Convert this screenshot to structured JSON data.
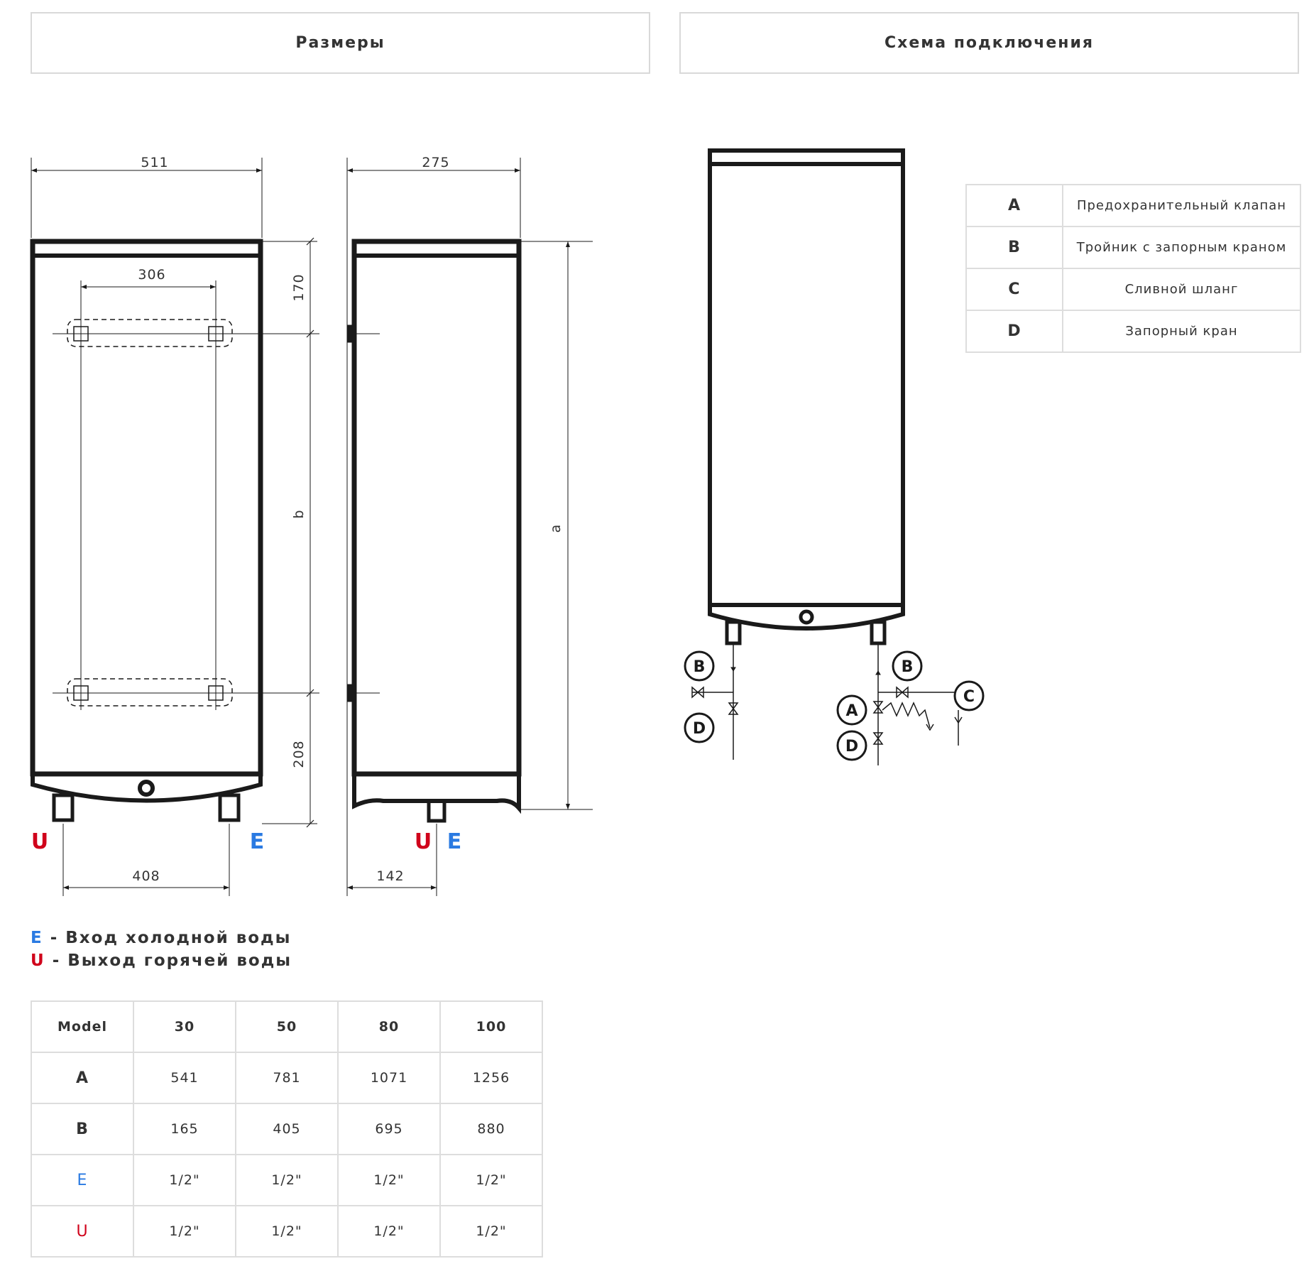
{
  "tabs": {
    "dimensions": "Размеры",
    "connection": "Схема подключения"
  },
  "colors": {
    "cold": "#2a7ae2",
    "hot": "#d0021b",
    "line": "#1a1a1a"
  },
  "front_view": {
    "width": "511",
    "mount_spacing": "306",
    "top_offset": "170",
    "b_label": "b",
    "bottom_offset": "208",
    "pipe_spacing": "408",
    "left_pipe": "U",
    "right_pipe": "E"
  },
  "side_view": {
    "depth": "275",
    "a_label": "a",
    "pipe_offset": "142",
    "pipe_u": "U",
    "pipe_e": "E"
  },
  "legend": {
    "cold_key": "E",
    "cold_text": " - Вход холодной воды",
    "hot_key": "U",
    "hot_text": " - Выход горячей воды"
  },
  "model_table": {
    "header": [
      "Model",
      "30",
      "50",
      "80",
      "100"
    ],
    "rows": [
      [
        "A",
        "541",
        "781",
        "1071",
        "1256"
      ],
      [
        "B",
        "165",
        "405",
        "695",
        "880"
      ],
      [
        "E",
        "1/2\"",
        "1/2\"",
        "1/2\"",
        "1/2\""
      ],
      [
        "U",
        "1/2\"",
        "1/2\"",
        "1/2\"",
        "1/2\""
      ]
    ]
  },
  "connection_legend": [
    {
      "key": "A",
      "text": "Предохранительный клапан"
    },
    {
      "key": "B",
      "text": "Тройник с запорным краном"
    },
    {
      "key": "C",
      "text": "Сливной шланг"
    },
    {
      "key": "D",
      "text": "Запорный кран"
    }
  ],
  "schema_labels": {
    "b1": "B",
    "d1": "D",
    "b2": "B",
    "a": "A",
    "c": "C",
    "d2": "D"
  }
}
